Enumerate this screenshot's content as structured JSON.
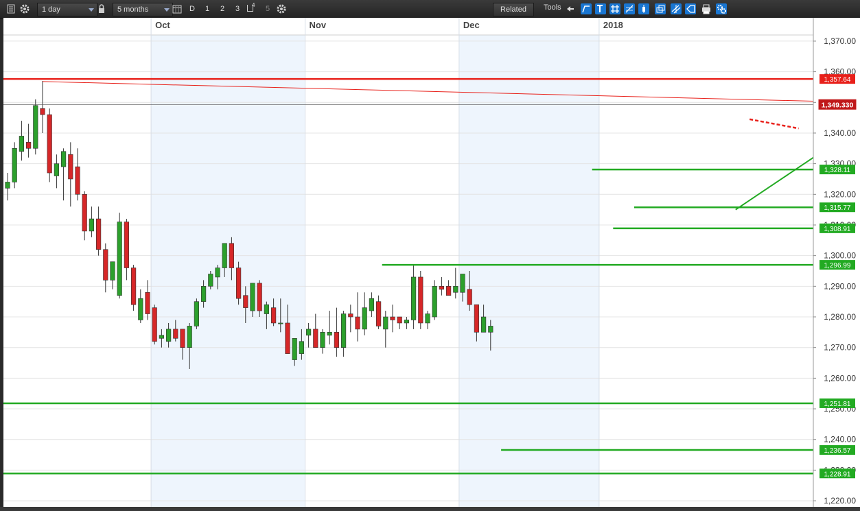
{
  "toolbar": {
    "interval": "1 day",
    "range": "5 months",
    "period_buttons": [
      "D",
      "1",
      "2",
      "3",
      "4",
      "5"
    ],
    "related_label": "Related",
    "tools_label": "Tools"
  },
  "colors": {
    "up": "#2ca02c",
    "down": "#d62728",
    "level": "#22aa22",
    "resistance": "#e8201a",
    "shade": "#eef5fd"
  },
  "chart_data": {
    "type": "candlestick",
    "interval": "1 day",
    "y_axis": {
      "min": 1218,
      "max": 1372,
      "ticks": [
        1370,
        1360,
        1350,
        1340,
        1330,
        1320,
        1310,
        1300,
        1290,
        1280,
        1270,
        1260,
        1250,
        1240,
        1230,
        1220
      ],
      "tick_labels": [
        "1,370.00",
        "1,360.00",
        "1,350.00",
        "1,340.00",
        "1,330.00",
        "1,320.00",
        "1,310.00",
        "1,300.00",
        "1,290.00",
        "1,280.00",
        "1,270.00",
        "1,260.00",
        "1,250.00",
        "1,240.00",
        "1,230.00",
        "1,220.00"
      ]
    },
    "month_labels": [
      {
        "label": "Oct",
        "bar": 21
      },
      {
        "label": "Nov",
        "bar": 43
      },
      {
        "label": "Dec",
        "bar": 65
      },
      {
        "label": "2018",
        "bar": 85
      }
    ],
    "shaded_months": [
      {
        "from": 21,
        "to": 43
      },
      {
        "from": 65,
        "to": 85
      }
    ],
    "candles": [
      [
        1322,
        1327,
        1318,
        1324
      ],
      [
        1324,
        1337,
        1322,
        1335
      ],
      [
        1334,
        1344,
        1331,
        1339
      ],
      [
        1337,
        1343,
        1332,
        1335
      ],
      [
        1335,
        1351,
        1333,
        1349
      ],
      [
        1348,
        1357,
        1340,
        1346
      ],
      [
        1346,
        1348,
        1324,
        1327
      ],
      [
        1326,
        1333,
        1322,
        1330
      ],
      [
        1329,
        1335,
        1318,
        1334
      ],
      [
        1333,
        1337,
        1316,
        1325
      ],
      [
        1329,
        1335,
        1318,
        1320
      ],
      [
        1320,
        1321,
        1305,
        1308
      ],
      [
        1308,
        1316,
        1306,
        1312
      ],
      [
        1312,
        1316,
        1300,
        1302
      ],
      [
        1302,
        1304,
        1288,
        1292
      ],
      [
        1292,
        1298,
        1289,
        1298
      ],
      [
        1287,
        1314,
        1286,
        1311
      ],
      [
        1311,
        1312,
        1292,
        1296
      ],
      [
        1296,
        1297,
        1282,
        1284
      ],
      [
        1279,
        1289,
        1278,
        1286
      ],
      [
        1288,
        1292,
        1279,
        1281
      ],
      [
        1283,
        1284,
        1271,
        1272
      ],
      [
        1273,
        1276,
        1270,
        1274
      ],
      [
        1272,
        1278,
        1270,
        1276
      ],
      [
        1276,
        1279,
        1272,
        1273
      ],
      [
        1276,
        1276,
        1266,
        1270
      ],
      [
        1270,
        1278,
        1263,
        1277
      ],
      [
        1277,
        1286,
        1276,
        1285
      ],
      [
        1285,
        1292,
        1283,
        1290
      ],
      [
        1290,
        1295,
        1289,
        1294
      ],
      [
        1293,
        1297,
        1289,
        1296
      ],
      [
        1296,
        1304,
        1293,
        1304
      ],
      [
        1304,
        1306,
        1292,
        1296
      ],
      [
        1296,
        1298,
        1284,
        1286
      ],
      [
        1287,
        1290,
        1278,
        1283
      ],
      [
        1282,
        1291,
        1280,
        1291
      ],
      [
        1291,
        1292,
        1280,
        1282
      ],
      [
        1281,
        1285,
        1276,
        1284
      ],
      [
        1283,
        1286,
        1277,
        1278
      ],
      [
        1278,
        1286,
        1275,
        1278
      ],
      [
        1278,
        1284,
        1271,
        1268
      ],
      [
        1266,
        1271,
        1264,
        1273
      ],
      [
        1268,
        1276,
        1266,
        1272
      ],
      [
        1274,
        1278,
        1270,
        1276
      ],
      [
        1276,
        1281,
        1272,
        1270
      ],
      [
        1270,
        1276,
        1268,
        1275
      ],
      [
        1274,
        1282,
        1271,
        1275
      ],
      [
        1275,
        1283,
        1267,
        1270
      ],
      [
        1270,
        1282,
        1267,
        1281
      ],
      [
        1281,
        1284,
        1275,
        1280
      ],
      [
        1280,
        1288,
        1272,
        1276
      ],
      [
        1276,
        1288,
        1274,
        1283
      ],
      [
        1282,
        1288,
        1280,
        1286
      ],
      [
        1285,
        1287,
        1276,
        1277
      ],
      [
        1276,
        1282,
        1270,
        1280
      ],
      [
        1280,
        1284,
        1275,
        1279
      ],
      [
        1280,
        1280,
        1276,
        1278
      ],
      [
        1278,
        1280,
        1276,
        1279
      ],
      [
        1279,
        1297,
        1276,
        1293
      ],
      [
        1293,
        1295,
        1276,
        1278
      ],
      [
        1278,
        1282,
        1276,
        1281
      ],
      [
        1280,
        1292,
        1279,
        1290
      ],
      [
        1290,
        1293,
        1287,
        1289
      ],
      [
        1290,
        1292,
        1287,
        1287
      ],
      [
        1288,
        1296,
        1286,
        1290
      ],
      [
        1288,
        1292,
        1285,
        1294
      ],
      [
        1289,
        1295,
        1282,
        1284
      ],
      [
        1284,
        1284,
        1272,
        1275
      ],
      [
        1275,
        1284,
        1275,
        1280
      ],
      [
        1275,
        1279,
        1269,
        1277
      ]
    ],
    "levels": [
      {
        "value": 1357.64,
        "label": "1,357.64",
        "type": "resistance",
        "from_bar": 0
      },
      {
        "value": 1328.11,
        "label": "1,328.11",
        "type": "support",
        "from_bar": 84
      },
      {
        "value": 1315.77,
        "label": "1,315.77",
        "type": "support",
        "from_bar": 90
      },
      {
        "value": 1308.91,
        "label": "1,308.91",
        "type": "support",
        "from_bar": 87
      },
      {
        "value": 1296.99,
        "label": "1,296.99",
        "type": "support",
        "from_bar": 54
      },
      {
        "value": 1251.81,
        "label": "1,251.81",
        "type": "support",
        "from_bar": 0
      },
      {
        "value": 1236.57,
        "label": "1,236.57",
        "type": "support",
        "from_bar": 71
      },
      {
        "value": 1228.91,
        "label": "1,228.91",
        "type": "support",
        "from_bar": 0
      }
    ],
    "current_price": {
      "value": 1349.33,
      "label": "1,349.330"
    }
  }
}
